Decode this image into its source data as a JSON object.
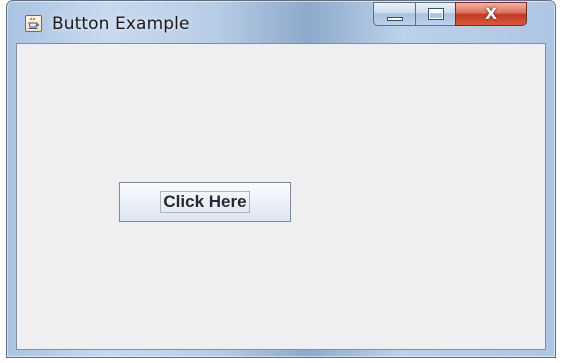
{
  "window": {
    "title": "Button Example",
    "icon": "java-coffee-cup-icon",
    "controls": {
      "minimize": "minimize-icon",
      "maximize": "maximize-icon",
      "close": "close-icon",
      "close_glyph": "X"
    }
  },
  "content": {
    "button_label": "Click Here"
  },
  "colors": {
    "client_background": "#efeff1",
    "close_button": "#c43a22",
    "title_bar": "#b8cde6"
  }
}
